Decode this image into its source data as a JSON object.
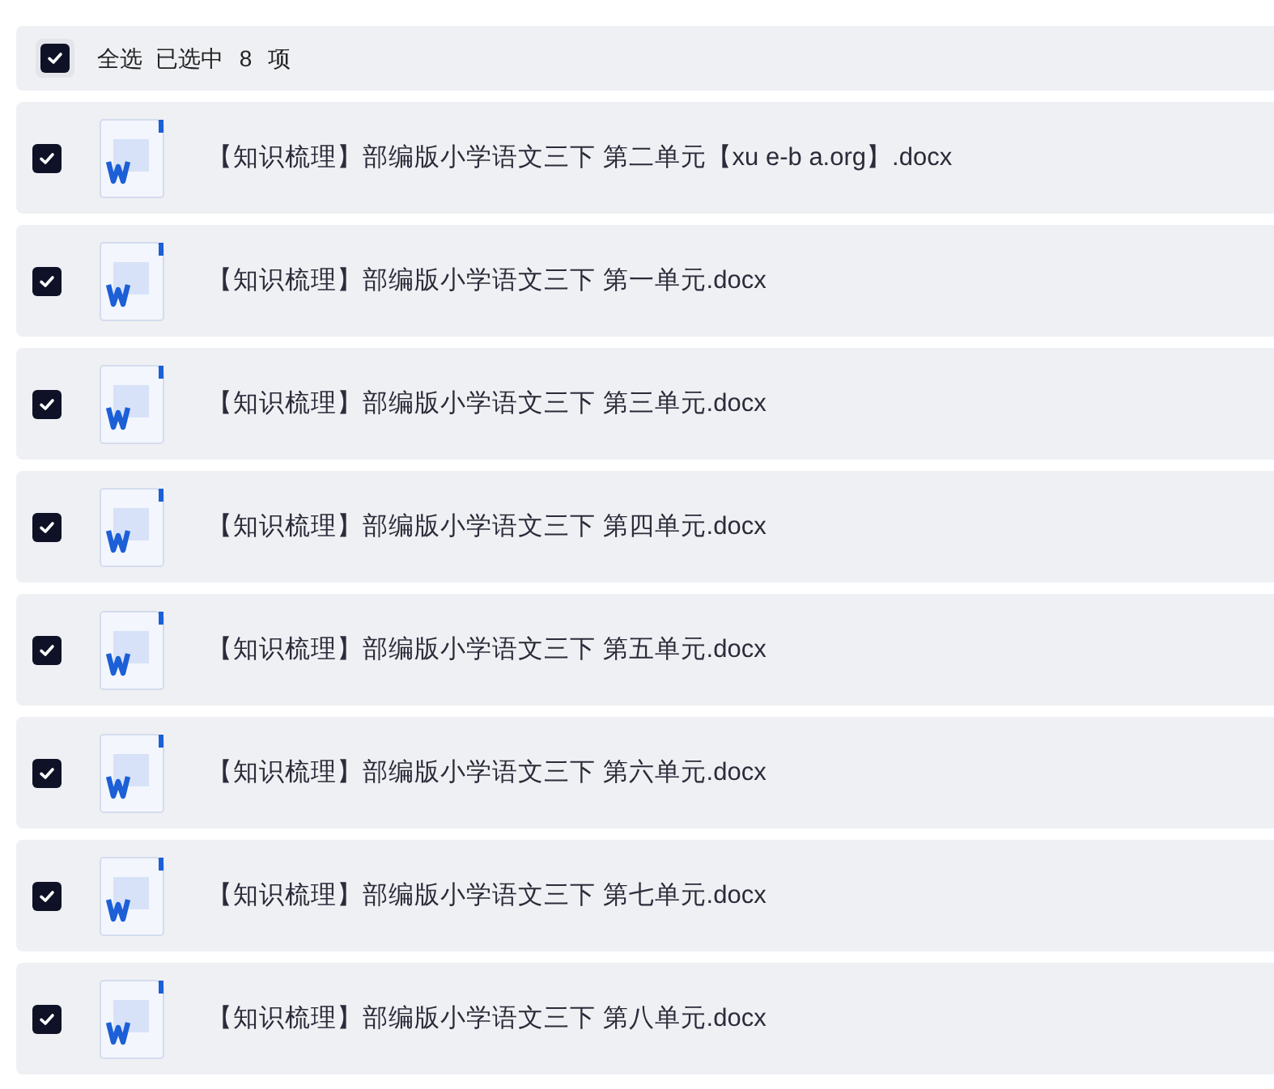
{
  "header": {
    "checked": true,
    "select_all_label": "全选",
    "selection_summary": "已选中 8 项"
  },
  "files": [
    {
      "name": "【知识梳理】部编版小学语文三下 第二单元【xu e-b a.org】.docx",
      "checked": true
    },
    {
      "name": "【知识梳理】部编版小学语文三下 第一单元.docx",
      "checked": true
    },
    {
      "name": "【知识梳理】部编版小学语文三下 第三单元.docx",
      "checked": true
    },
    {
      "name": "【知识梳理】部编版小学语文三下 第四单元.docx",
      "checked": true
    },
    {
      "name": "【知识梳理】部编版小学语文三下 第五单元.docx",
      "checked": true
    },
    {
      "name": "【知识梳理】部编版小学语文三下 第六单元.docx",
      "checked": true
    },
    {
      "name": "【知识梳理】部编版小学语文三下 第七单元.docx",
      "checked": true
    },
    {
      "name": "【知识梳理】部编版小学语文三下 第八单元.docx",
      "checked": true
    }
  ]
}
